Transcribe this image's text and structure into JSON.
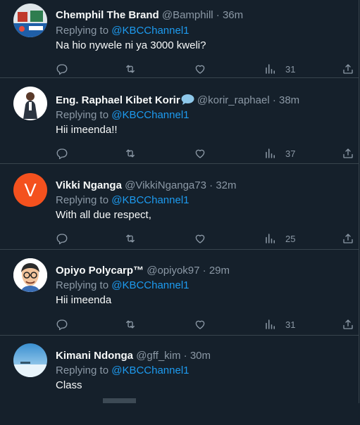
{
  "tweets": [
    {
      "name": "Chemphil The Brand",
      "handle": "@Bamphill",
      "time": "36m",
      "replying_prefix": "Replying to",
      "replying_to": "@KBCChannel1",
      "text": "Na hio nywele ni ya 3000 kweli?",
      "views": "31",
      "avatar": "photo",
      "verified": false
    },
    {
      "name": "Eng. Raphael Kibet Korir",
      "handle": "@korir_raphael",
      "time": "38m",
      "replying_prefix": "Replying to",
      "replying_to": "@KBCChannel1",
      "text": "Hii imeenda!!",
      "views": "37",
      "avatar": "photo",
      "verified": true
    },
    {
      "name": "Vikki Nganga",
      "handle": "@VikkiNganga73",
      "time": "32m",
      "replying_prefix": "Replying to",
      "replying_to": "@KBCChannel1",
      "text": "With all due respect,",
      "views": "25",
      "avatar": "letter",
      "avatar_letter": "V",
      "avatar_color": "#f4511e",
      "verified": false
    },
    {
      "name": "Opiyo Polycarp™",
      "handle": "@opiyok97",
      "time": "29m",
      "replying_prefix": "Replying to",
      "replying_to": "@KBCChannel1",
      "text": "Hii imeenda",
      "views": "31",
      "avatar": "cartoon",
      "verified": false
    },
    {
      "name": "Kimani Ndonga",
      "handle": "@gff_kim",
      "time": "30m",
      "replying_prefix": "Replying to",
      "replying_to": "@KBCChannel1",
      "text": "Class",
      "views": "",
      "avatar": "photo",
      "verified": false
    }
  ],
  "colors": {
    "background": "#15202b",
    "border": "#38444d",
    "text": "#f7f9f9",
    "muted": "#8b98a5",
    "link": "#1d9bf0"
  }
}
